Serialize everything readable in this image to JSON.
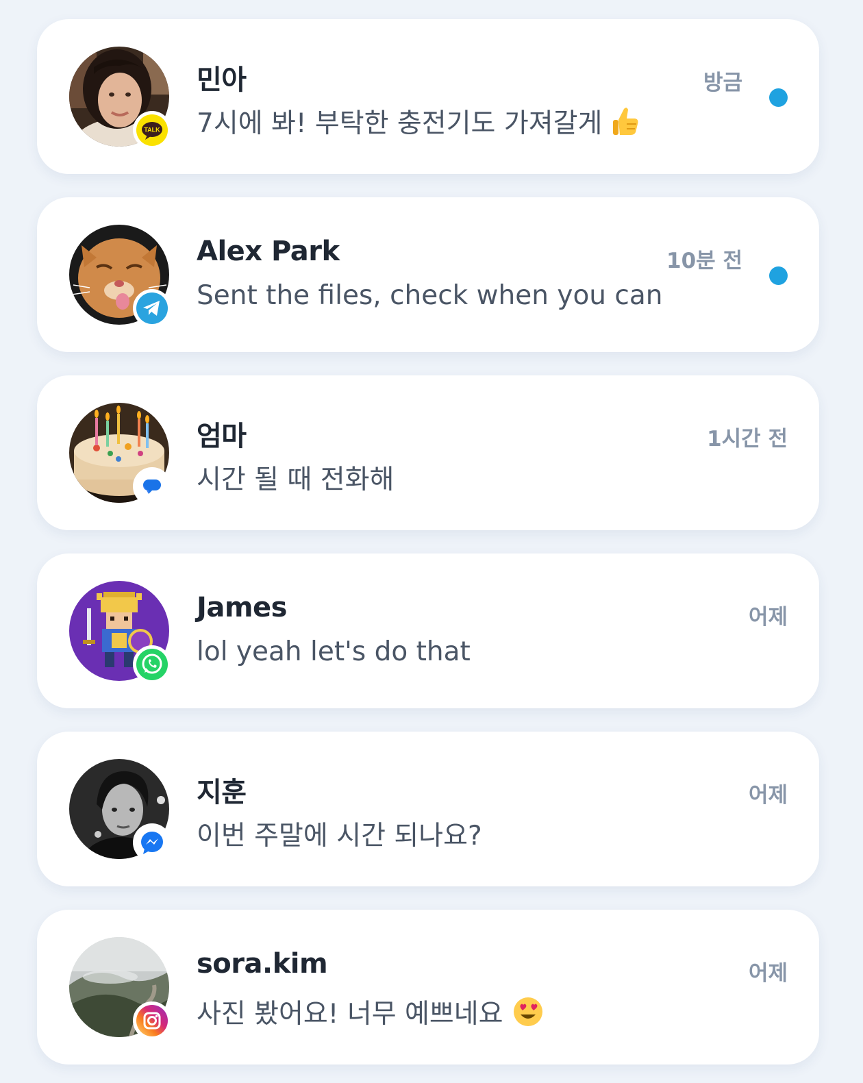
{
  "colors": {
    "background": "#eef3f9",
    "card": "#ffffff",
    "name": "#1f2733",
    "preview": "#4a5565",
    "time": "#8795a8",
    "unread_dot": "#1fa2e0"
  },
  "conversations": [
    {
      "name": "민아",
      "preview": "7시에 봐! 부탁한 충전기도 가져갈게",
      "preview_emoji": "thumbs-up-emoji",
      "time": "방금",
      "unread": true,
      "platform": "kakaotalk",
      "platform_badge_text": "TALK",
      "avatar": "photo-woman-smiling"
    },
    {
      "name": "Alex Park",
      "preview": "Sent the files, check when you can",
      "time": "10분 전",
      "unread": true,
      "platform": "telegram",
      "avatar": "photo-orange-cat"
    },
    {
      "name": "엄마",
      "preview": "시간 될 때 전화해",
      "time": "1시간 전",
      "unread": false,
      "platform": "google-messages",
      "avatar": "photo-birthday-cake"
    },
    {
      "name": "James",
      "preview": "lol yeah let's do that",
      "time": "어제",
      "unread": false,
      "platform": "whatsapp",
      "avatar": "pixel-art-knight"
    },
    {
      "name": "지훈",
      "preview": "이번 주말에 시간 되나요?",
      "time": "어제",
      "unread": false,
      "platform": "messenger",
      "avatar": "photo-bw-portrait"
    },
    {
      "name": "sora.kim",
      "preview": "사진 봤어요! 너무 예쁘네요",
      "preview_emoji": "heart-eyes-emoji",
      "time": "어제",
      "unread": false,
      "platform": "instagram",
      "avatar": "photo-misty-mountain"
    }
  ]
}
